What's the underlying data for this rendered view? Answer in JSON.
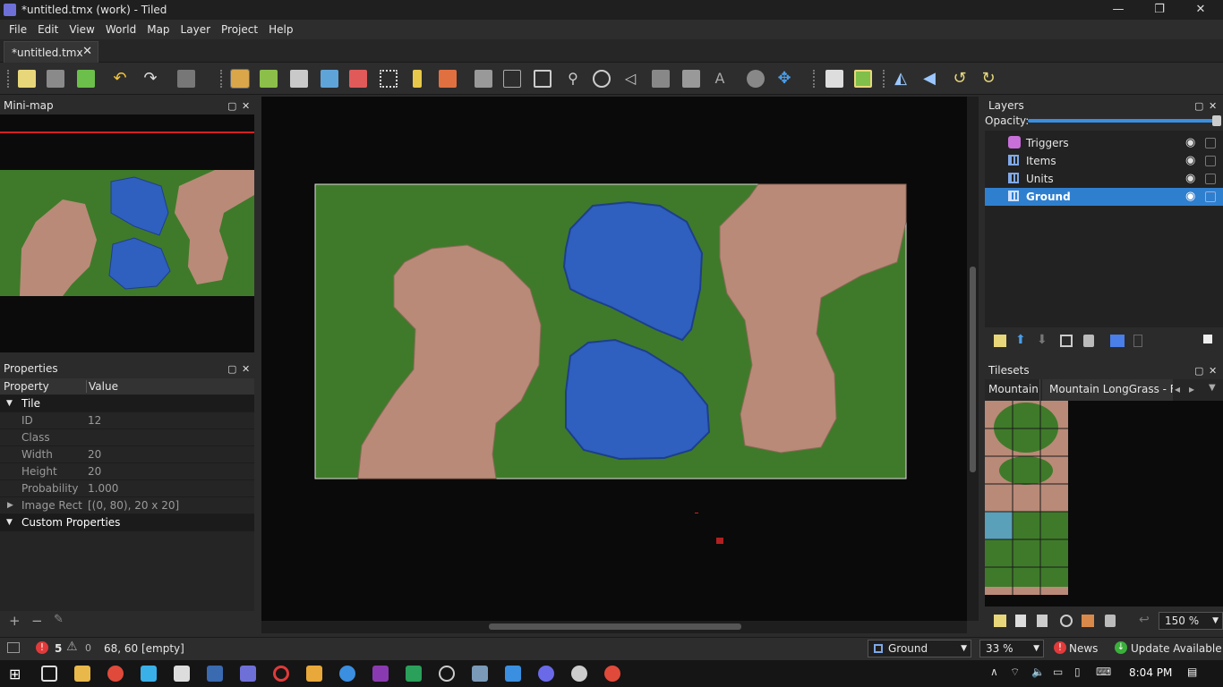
{
  "window": {
    "title": "*untitled.tmx (work) - Tiled",
    "minimize": "—",
    "maximize": "❐",
    "close": "✕"
  },
  "menu": [
    "File",
    "Edit",
    "View",
    "World",
    "Map",
    "Layer",
    "Project",
    "Help"
  ],
  "document_tab": {
    "label": "*untitled.tmx",
    "close": "✕"
  },
  "colors": {
    "accent": "#2f7fcf",
    "grass": "#3f7a2a",
    "dirt": "#b98a78",
    "water": "#2f5fbf",
    "minimap_viewport": "#d32020"
  },
  "minimap": {
    "title": "Mini-map"
  },
  "properties": {
    "title": "Properties",
    "col_property": "Property",
    "col_value": "Value",
    "rows": [
      {
        "key": "Tile",
        "value": "",
        "group": true
      },
      {
        "key": "ID",
        "value": "12"
      },
      {
        "key": "Class",
        "value": ""
      },
      {
        "key": "Width",
        "value": "20"
      },
      {
        "key": "Height",
        "value": "20"
      },
      {
        "key": "Probability",
        "value": "1.000"
      },
      {
        "key": "Image Rect",
        "value": "[(0, 80), 20 x 20]"
      },
      {
        "key": "Custom Properties",
        "value": "",
        "group": true
      }
    ],
    "add": "+",
    "remove": "−",
    "edit": "✎"
  },
  "layers": {
    "title": "Layers",
    "opacity_label": "Opacity:",
    "opacity": 1.0,
    "items": [
      {
        "name": "Triggers",
        "type": "object",
        "selected": false
      },
      {
        "name": "Items",
        "type": "tile",
        "selected": false
      },
      {
        "name": "Units",
        "type": "tile",
        "selected": false
      },
      {
        "name": "Ground",
        "type": "tile",
        "selected": true
      }
    ]
  },
  "tilesets": {
    "title": "Tilesets",
    "tabs": [
      "Mountain",
      "Mountain LongGrass - Flat"
    ],
    "zoom": "150 %"
  },
  "status": {
    "errors": "5",
    "warnings": "0",
    "coords": "68, 60 [empty]",
    "layer_select": "Ground",
    "zoom": "33 %",
    "news": "News",
    "update": "Update Available"
  },
  "taskbar": {
    "time": "8:04 PM"
  }
}
